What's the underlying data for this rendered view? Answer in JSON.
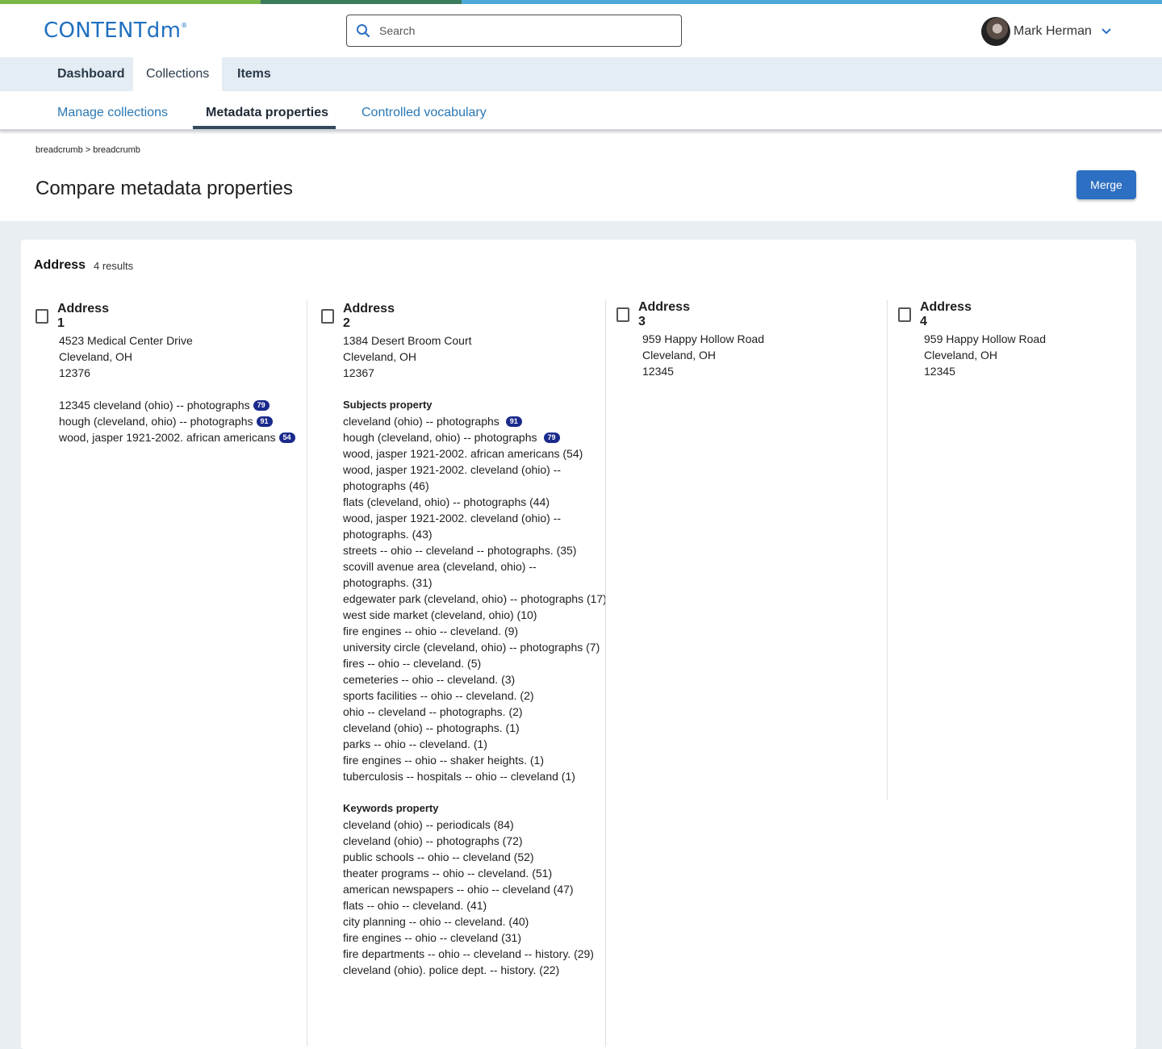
{
  "app": {
    "logo": "CONTENTdm",
    "logo_mark": "®"
  },
  "search": {
    "placeholder": "Search",
    "value": ""
  },
  "user": {
    "name": "Mark Herman"
  },
  "main_nav": {
    "tabs": [
      {
        "label": "Dashboard",
        "active": false
      },
      {
        "label": "Collections",
        "active": true
      },
      {
        "label": "Items",
        "active": false
      }
    ]
  },
  "sub_nav": {
    "tabs": [
      {
        "label": "Manage collections",
        "active": false
      },
      {
        "label": "Metadata properties",
        "active": true
      },
      {
        "label": "Controlled vocabulary",
        "active": false
      }
    ]
  },
  "page": {
    "breadcrumb": "breadcrumb > breadcrumb",
    "title": "Compare metadata properties",
    "merge_label": "Merge"
  },
  "card": {
    "title": "Address",
    "count": "4 results",
    "columns": [
      {
        "title": "Address 1",
        "address": [
          "4523 Medical Center Drive",
          "Cleveland, OH",
          "12376"
        ],
        "values": [
          {
            "text": "12345 cleveland (ohio) -- photographs",
            "badge": "79"
          },
          {
            "text": "hough (cleveland, ohio) -- photographs",
            "badge": "91"
          },
          {
            "text": "wood, jasper 1921-2002. african americans",
            "badge": "54"
          }
        ]
      },
      {
        "title": "Address 2",
        "address": [
          "1384 Desert Broom Court",
          "Cleveland, OH",
          "12367"
        ],
        "subjects_heading": "Subjects property",
        "subjects": [
          {
            "text": "cleveland (ohio) -- photographs",
            "badge": "91"
          },
          {
            "text": "hough (cleveland, ohio) -- photographs",
            "badge": "79"
          },
          {
            "text": "wood, jasper 1921-2002. african americans (54)"
          },
          {
            "text": "wood, jasper 1921-2002. cleveland (ohio) --"
          },
          {
            "text": "photographs (46)"
          },
          {
            "text": "flats (cleveland, ohio) -- photographs (44)"
          },
          {
            "text": "wood, jasper 1921-2002. cleveland (ohio) --"
          },
          {
            "text": "photographs. (43)"
          },
          {
            "text": "streets -- ohio -- cleveland -- photographs. (35)"
          },
          {
            "text": "scovill avenue area (cleveland, ohio) --"
          },
          {
            "text": "photographs. (31)"
          },
          {
            "text": "edgewater park (cleveland, ohio) -- photographs (17)"
          },
          {
            "text": "west side market (cleveland, ohio) (10)"
          },
          {
            "text": "fire engines -- ohio -- cleveland. (9)"
          },
          {
            "text": "university circle (cleveland, ohio) -- photographs (7)"
          },
          {
            "text": "fires -- ohio -- cleveland. (5)"
          },
          {
            "text": "cemeteries -- ohio -- cleveland. (3)"
          },
          {
            "text": "sports facilities -- ohio -- cleveland. (2)"
          },
          {
            "text": "ohio -- cleveland -- photographs. (2)"
          },
          {
            "text": "cleveland (ohio) -- photographs. (1)"
          },
          {
            "text": "parks -- ohio -- cleveland. (1)"
          },
          {
            "text": "fire engines -- ohio -- shaker heights. (1)"
          },
          {
            "text": "tuberculosis -- hospitals -- ohio -- cleveland (1)"
          }
        ],
        "keywords_heading": "Keywords property",
        "keywords": [
          "cleveland (ohio) -- periodicals (84)",
          "cleveland (ohio) -- photographs (72)",
          "public schools -- ohio -- cleveland (52)",
          "theater programs -- ohio -- cleveland. (51)",
          "american newspapers -- ohio -- cleveland (47)",
          "flats -- ohio -- cleveland. (41)",
          "city planning -- ohio -- cleveland. (40)",
          "fire engines -- ohio -- cleveland (31)",
          "fire departments -- ohio -- cleveland -- history. (29)",
          "cleveland (ohio). police dept. -- history. (22)"
        ]
      },
      {
        "title": "Address 3",
        "address": [
          "959 Happy Hollow Road",
          "Cleveland, OH",
          "12345"
        ]
      },
      {
        "title": "Address 4",
        "address": [
          "959 Happy Hollow Road",
          "Cleveland, OH",
          "12345"
        ]
      }
    ]
  },
  "colors": {
    "brand": "#1f6fbf",
    "primary_button": "#2d6fc2",
    "badge": "#1a2a8c",
    "link": "#2a78b5"
  }
}
